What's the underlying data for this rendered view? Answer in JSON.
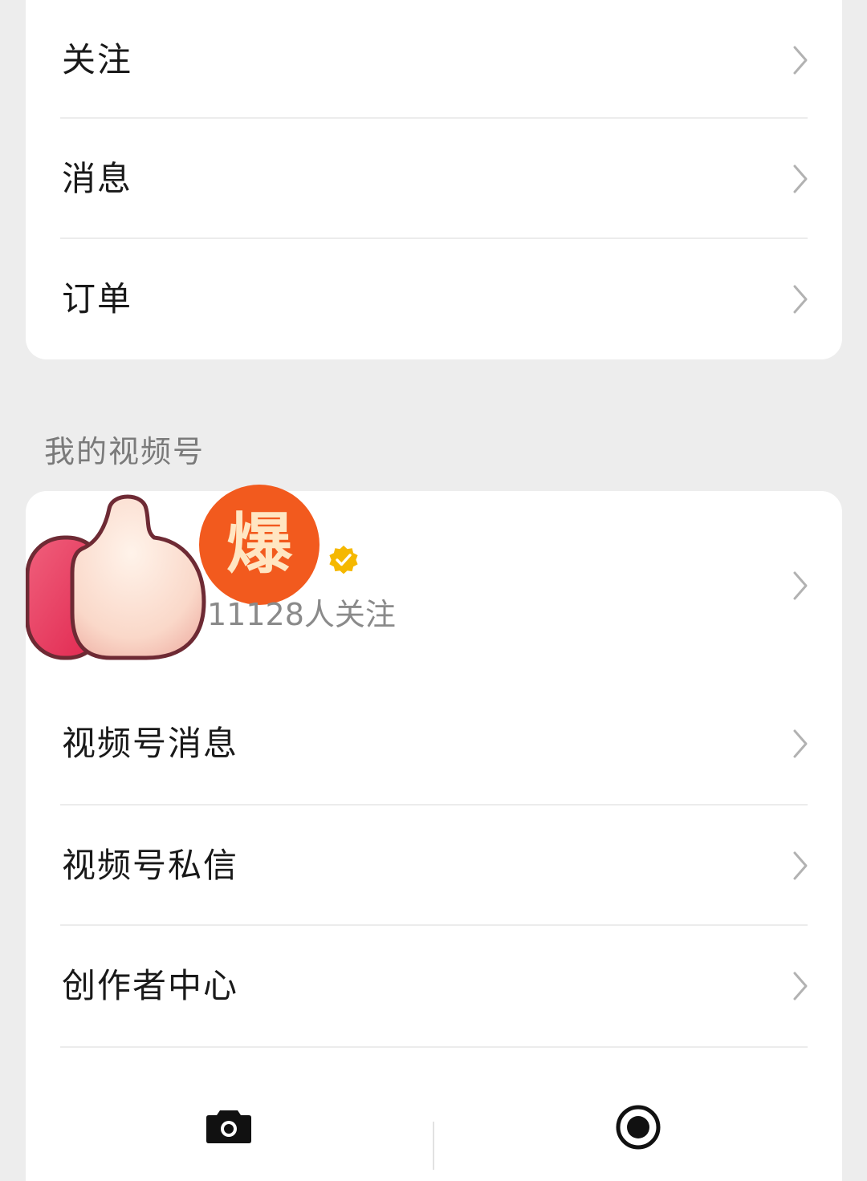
{
  "top_menu": [
    {
      "label": "关注"
    },
    {
      "label": "消息"
    },
    {
      "label": "订单"
    }
  ],
  "channels_section": {
    "title": "我的视频号",
    "profile": {
      "badge_text": "爆",
      "followers_text": "11128人关注",
      "badge_color": "#f25a1e",
      "verified_color": "#f5b800"
    },
    "menu": [
      {
        "label": "视频号消息"
      },
      {
        "label": "视频号私信"
      },
      {
        "label": "创作者中心"
      }
    ],
    "actions": [
      {
        "icon": "camera-icon"
      },
      {
        "icon": "live-record-icon"
      }
    ]
  },
  "colors": {
    "page_background": "#ededed",
    "card_background": "#ffffff",
    "primary_text": "#191919",
    "secondary_text": "#8a8a8a",
    "chevron": "#b2b2b2"
  }
}
